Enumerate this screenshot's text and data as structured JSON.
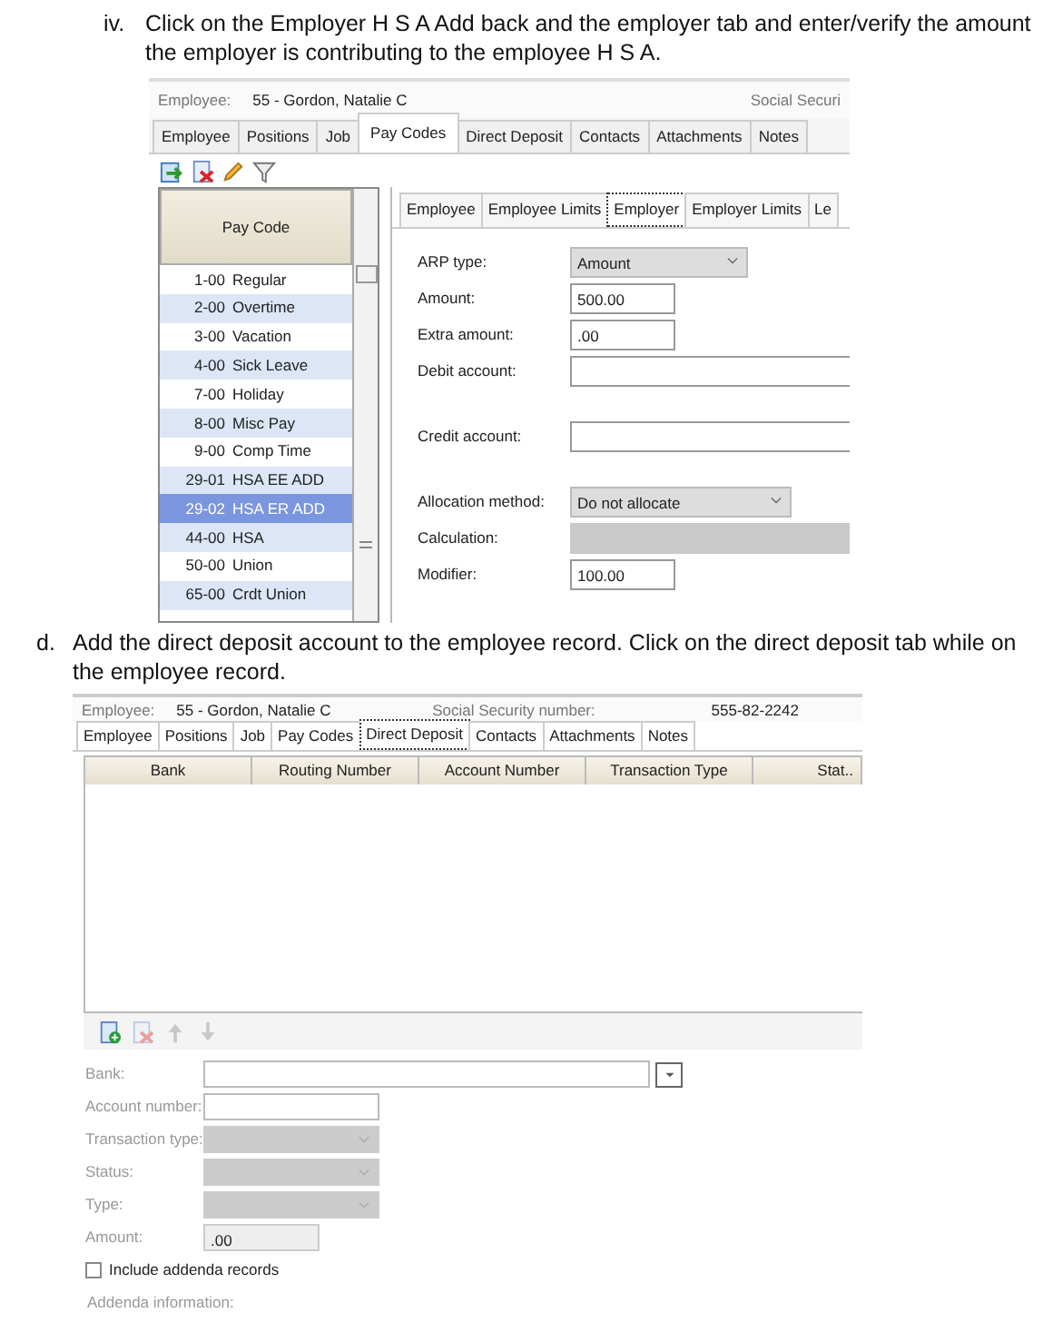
{
  "step_iv": {
    "marker": "iv.",
    "text": "Click on the Employer H S A Add back and the employer tab and enter/verify the amount the employer is contributing to the employee H S A."
  },
  "screenshot_1": {
    "employee_label": "Employee:",
    "employee_value": "55 - Gordon, Natalie C",
    "ssn_label": "Social Securi",
    "tabs": [
      {
        "label": "Employee",
        "selected": false
      },
      {
        "label": "Positions",
        "selected": false
      },
      {
        "label": "Job",
        "selected": false
      },
      {
        "label": "Pay Codes",
        "selected": true
      },
      {
        "label": "Direct Deposit",
        "selected": false
      },
      {
        "label": "Contacts",
        "selected": false
      },
      {
        "label": "Attachments",
        "selected": false
      },
      {
        "label": "Notes",
        "selected": false
      }
    ],
    "toolbar": [
      {
        "kind": "import",
        "disabled": false
      },
      {
        "kind": "delete",
        "disabled": false
      },
      {
        "kind": "edit",
        "disabled": false
      },
      {
        "kind": "filter",
        "disabled": false
      }
    ],
    "pay_code_header": "Pay Code",
    "pay_codes": [
      {
        "code": "1-00",
        "name": "Regular",
        "selected": false
      },
      {
        "code": "2-00",
        "name": "Overtime",
        "selected": false
      },
      {
        "code": "3-00",
        "name": "Vacation",
        "selected": false
      },
      {
        "code": "4-00",
        "name": "Sick Leave",
        "selected": false
      },
      {
        "code": "7-00",
        "name": "Holiday",
        "selected": false
      },
      {
        "code": "8-00",
        "name": "Misc Pay",
        "selected": false
      },
      {
        "code": "9-00",
        "name": "Comp Time",
        "selected": false
      },
      {
        "code": "29-01",
        "name": "HSA EE ADD",
        "selected": false
      },
      {
        "code": "29-02",
        "name": "HSA ER ADD",
        "selected": true
      },
      {
        "code": "44-00",
        "name": "HSA",
        "selected": false
      },
      {
        "code": "50-00",
        "name": "Union",
        "selected": false
      },
      {
        "code": "65-00",
        "name": "Crdt Union",
        "selected": false
      }
    ],
    "subtabs": [
      {
        "label": "Employee",
        "selected": false
      },
      {
        "label": "Employee Limits",
        "selected": false
      },
      {
        "label": "Employer",
        "selected": true
      },
      {
        "label": "Employer Limits",
        "selected": false
      },
      {
        "label": "Le",
        "selected": false
      }
    ],
    "form": [
      {
        "label": "ARP type:",
        "kind": "select",
        "value": "Amount",
        "disabled": false
      },
      {
        "label": "Amount:",
        "kind": "short",
        "value": "500.00",
        "disabled": false
      },
      {
        "label": "Extra amount:",
        "kind": "short",
        "value": ".00",
        "disabled": false
      },
      {
        "label": "Debit account:",
        "kind": "wide",
        "disabled": false
      },
      {
        "label": "Credit account:",
        "kind": "wide",
        "disabled": false
      },
      {
        "label": "Allocation method:",
        "kind": "wide-select",
        "value": "Do not allocate",
        "disabled": false
      },
      {
        "label": "Calculation:",
        "kind": "wide",
        "disabled": true
      },
      {
        "label": "Modifier:",
        "kind": "short",
        "value": "100.00",
        "disabled": false
      }
    ]
  },
  "step_d": {
    "marker": "d.",
    "text": "Add the direct deposit account to the employee record.  Click on the direct deposit tab while on the employee record."
  },
  "screenshot_2": {
    "employee_label": "Employee:",
    "employee_value": "55 - Gordon, Natalie C",
    "ssn_label": "Social Security number:",
    "ssn_value": "555-82-2242",
    "tabs": [
      {
        "label": "Employee",
        "selected": false
      },
      {
        "label": "Positions",
        "selected": false
      },
      {
        "label": "Job",
        "selected": false
      },
      {
        "label": "Pay Codes",
        "selected": false
      },
      {
        "label": "Direct Deposit",
        "selected": true
      },
      {
        "label": "Contacts",
        "selected": false
      },
      {
        "label": "Attachments",
        "selected": false
      },
      {
        "label": "Notes",
        "selected": false
      }
    ],
    "columns": [
      "Bank",
      "Routing Number",
      "Account Number",
      "Transaction Type",
      "Stat.."
    ],
    "toolbar": [
      {
        "kind": "add",
        "disabled": false
      },
      {
        "kind": "delete",
        "disabled": true
      },
      {
        "kind": "up",
        "disabled": true
      },
      {
        "kind": "down",
        "disabled": true
      }
    ],
    "form": [
      {
        "label": "Bank:",
        "kind": "combo",
        "disabled": false
      },
      {
        "label": "Account number:",
        "kind": "text",
        "disabled": false
      },
      {
        "label": "Transaction type:",
        "kind": "select",
        "disabled": true
      },
      {
        "label": "Status:",
        "kind": "select",
        "disabled": true
      },
      {
        "label": "Type:",
        "kind": "select",
        "disabled": true
      },
      {
        "label": "Amount:",
        "kind": "amount",
        "value": ".00",
        "disabled": true
      }
    ],
    "checkbox": {
      "label": "Include addenda records",
      "checked": false
    },
    "addenda_label": "Addenda information:"
  }
}
